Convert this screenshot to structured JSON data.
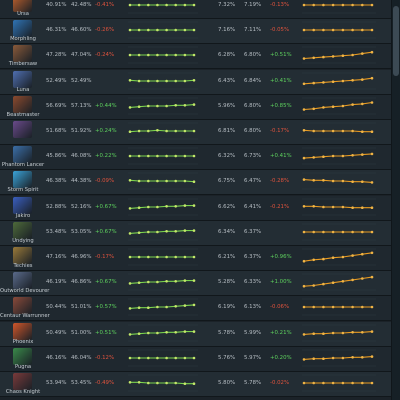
{
  "colors": {
    "positive": "#5ed25e",
    "negative": "#e0533d",
    "spark_green": "#7bd44d",
    "spark_green_light": "#c4e86a",
    "spark_orange": "#e89a21"
  },
  "rows": [
    {
      "hero": "Ursa",
      "color": "#c0612d",
      "wr1": "40.91%",
      "wr2": "42.48%",
      "ch1": "-0.41%",
      "x1": "7.32%",
      "x2": "7.19%",
      "ch2": "-0.13%",
      "green_levels": [
        0.5,
        0.5,
        0.5,
        0.5,
        0.5,
        0.5,
        0.5,
        0.5
      ],
      "orange_levels": [
        0.5,
        0.5,
        0.5,
        0.5,
        0.5,
        0.5,
        0.5,
        0.5
      ]
    },
    {
      "hero": "Morphling",
      "color": "#2f74b5",
      "wr1": "46.31%",
      "wr2": "46.60%",
      "ch1": "-0.26%",
      "x1": "7.16%",
      "x2": "7.11%",
      "ch2": "-0.05%",
      "green_levels": [
        0.5,
        0.5,
        0.5,
        0.5,
        0.5,
        0.5,
        0.5,
        0.5
      ],
      "orange_levels": [
        0.5,
        0.5,
        0.5,
        0.5,
        0.5,
        0.5,
        0.5,
        0.5
      ]
    },
    {
      "hero": "Timbersaw",
      "color": "#8a5a3a",
      "wr1": "47.28%",
      "wr2": "47.04%",
      "ch1": "-0.24%",
      "x1": "6.28%",
      "x2": "6.80%",
      "ch2": "+0.51%",
      "green_levels": [
        0.5,
        0.5,
        0.5,
        0.5,
        0.5,
        0.5,
        0.5,
        0.5
      ],
      "orange_levels": [
        0.25,
        0.3,
        0.35,
        0.4,
        0.45,
        0.5,
        0.6,
        0.7
      ]
    },
    {
      "hero": "Luna",
      "color": "#4f6fb0",
      "wr1": "52.49%",
      "wr2": "52.49%",
      "ch1": "",
      "x1": "6.43%",
      "x2": "6.84%",
      "ch2": "+0.41%",
      "green_levels": [
        0.55,
        0.5,
        0.5,
        0.5,
        0.5,
        0.5,
        0.5,
        0.55
      ],
      "orange_levels": [
        0.3,
        0.35,
        0.4,
        0.45,
        0.5,
        0.55,
        0.6,
        0.7
      ]
    },
    {
      "hero": "Beastmaster",
      "color": "#8c4a2e",
      "wr1": "56.69%",
      "wr2": "57.13%",
      "ch1": "+0.44%",
      "x1": "5.96%",
      "x2": "6.80%",
      "ch2": "+0.85%",
      "green_levels": [
        0.4,
        0.45,
        0.5,
        0.5,
        0.5,
        0.55,
        0.55,
        0.6
      ],
      "orange_levels": [
        0.25,
        0.3,
        0.4,
        0.45,
        0.5,
        0.6,
        0.65,
        0.75
      ]
    },
    {
      "hero": "",
      "color": "#6a4a8a",
      "wr1": "51.68%",
      "wr2": "51.92%",
      "ch1": "+0.24%",
      "x1": "6.81%",
      "x2": "6.80%",
      "ch2": "-0.17%",
      "green_levels": [
        0.45,
        0.5,
        0.5,
        0.55,
        0.5,
        0.5,
        0.5,
        0.5
      ],
      "orange_levels": [
        0.55,
        0.5,
        0.5,
        0.5,
        0.5,
        0.5,
        0.45,
        0.45
      ]
    },
    {
      "hero": "Phantom Lancer",
      "color": "#3b6fa8",
      "wr1": "45.86%",
      "wr2": "46.08%",
      "ch1": "+0.22%",
      "x1": "6.32%",
      "x2": "6.73%",
      "ch2": "+0.41%",
      "green_levels": [
        0.5,
        0.5,
        0.5,
        0.5,
        0.5,
        0.5,
        0.5,
        0.5
      ],
      "orange_levels": [
        0.35,
        0.4,
        0.45,
        0.5,
        0.5,
        0.55,
        0.6,
        0.65
      ]
    },
    {
      "hero": "Storm Spirit",
      "color": "#3aa3d8",
      "wr1": "46.38%",
      "wr2": "44.38%",
      "ch1": "-0.09%",
      "x1": "6.75%",
      "x2": "6.47%",
      "ch2": "-0.28%",
      "green_levels": [
        0.55,
        0.5,
        0.5,
        0.5,
        0.5,
        0.5,
        0.5,
        0.45
      ],
      "orange_levels": [
        0.6,
        0.55,
        0.55,
        0.5,
        0.5,
        0.45,
        0.45,
        0.4
      ]
    },
    {
      "hero": "Jakiro",
      "color": "#3a5fc0",
      "wr1": "52.88%",
      "wr2": "52.16%",
      "ch1": "+0.67%",
      "x1": "6.62%",
      "x2": "6.41%",
      "ch2": "-0.21%",
      "green_levels": [
        0.4,
        0.45,
        0.5,
        0.5,
        0.55,
        0.55,
        0.6,
        0.6
      ],
      "orange_levels": [
        0.55,
        0.55,
        0.5,
        0.5,
        0.5,
        0.45,
        0.45,
        0.45
      ]
    },
    {
      "hero": "Undying",
      "color": "#4e6a3a",
      "wr1": "53.48%",
      "wr2": "53.05%",
      "ch1": "+0.67%",
      "x1": "6.34%",
      "x2": "6.37%",
      "ch2": "",
      "green_levels": [
        0.4,
        0.45,
        0.5,
        0.5,
        0.55,
        0.55,
        0.6,
        0.6
      ],
      "orange_levels": [
        0.5,
        0.5,
        0.5,
        0.5,
        0.5,
        0.5,
        0.5,
        0.5
      ]
    },
    {
      "hero": "Techies",
      "color": "#9a7a3a",
      "wr1": "47.16%",
      "wr2": "46.96%",
      "ch1": "-0.17%",
      "x1": "6.21%",
      "x2": "6.37%",
      "ch2": "+0.96%",
      "green_levels": [
        0.5,
        0.5,
        0.5,
        0.5,
        0.5,
        0.5,
        0.5,
        0.5
      ],
      "orange_levels": [
        0.2,
        0.3,
        0.35,
        0.45,
        0.5,
        0.6,
        0.7,
        0.8
      ]
    },
    {
      "hero": "Outworld Devourer",
      "color": "#5a6a8a",
      "wr1": "46.19%",
      "wr2": "46.86%",
      "ch1": "+0.67%",
      "x1": "5.28%",
      "x2": "6.33%",
      "ch2": "+1.00%",
      "green_levels": [
        0.4,
        0.45,
        0.5,
        0.5,
        0.55,
        0.55,
        0.6,
        0.6
      ],
      "orange_levels": [
        0.2,
        0.25,
        0.35,
        0.45,
        0.55,
        0.65,
        0.75,
        0.85
      ]
    },
    {
      "hero": "Centaur Warrunner",
      "color": "#8a4a3a",
      "wr1": "50.44%",
      "wr2": "51.01%",
      "ch1": "+0.57%",
      "x1": "6.19%",
      "x2": "6.13%",
      "ch2": "-0.06%",
      "green_levels": [
        0.4,
        0.45,
        0.45,
        0.5,
        0.5,
        0.55,
        0.6,
        0.65
      ],
      "orange_levels": [
        0.5,
        0.5,
        0.5,
        0.5,
        0.5,
        0.5,
        0.5,
        0.5
      ]
    },
    {
      "hero": "Phoenix",
      "color": "#d0562a",
      "wr1": "50.49%",
      "wr2": "51.00%",
      "ch1": "+0.51%",
      "x1": "5.78%",
      "x2": "5.99%",
      "ch2": "+0.21%",
      "green_levels": [
        0.4,
        0.45,
        0.5,
        0.5,
        0.55,
        0.55,
        0.6,
        0.6
      ],
      "orange_levels": [
        0.4,
        0.45,
        0.45,
        0.5,
        0.5,
        0.55,
        0.55,
        0.6
      ]
    },
    {
      "hero": "Pugna",
      "color": "#3a8a4a",
      "wr1": "46.16%",
      "wr2": "46.04%",
      "ch1": "-0.12%",
      "x1": "5.76%",
      "x2": "5.97%",
      "ch2": "+0.20%",
      "green_levels": [
        0.5,
        0.5,
        0.5,
        0.5,
        0.5,
        0.5,
        0.5,
        0.5
      ],
      "orange_levels": [
        0.4,
        0.45,
        0.45,
        0.5,
        0.5,
        0.55,
        0.55,
        0.6
      ]
    },
    {
      "hero": "Chaos Knight",
      "color": "#7a3a3a",
      "wr1": "53.94%",
      "wr2": "53.45%",
      "ch1": "-0.49%",
      "x1": "5.80%",
      "x2": "5.78%",
      "ch2": "-0.02%",
      "green_levels": [
        0.55,
        0.55,
        0.5,
        0.5,
        0.5,
        0.5,
        0.45,
        0.45
      ],
      "orange_levels": [
        0.5,
        0.5,
        0.5,
        0.5,
        0.5,
        0.5,
        0.5,
        0.5
      ]
    }
  ]
}
